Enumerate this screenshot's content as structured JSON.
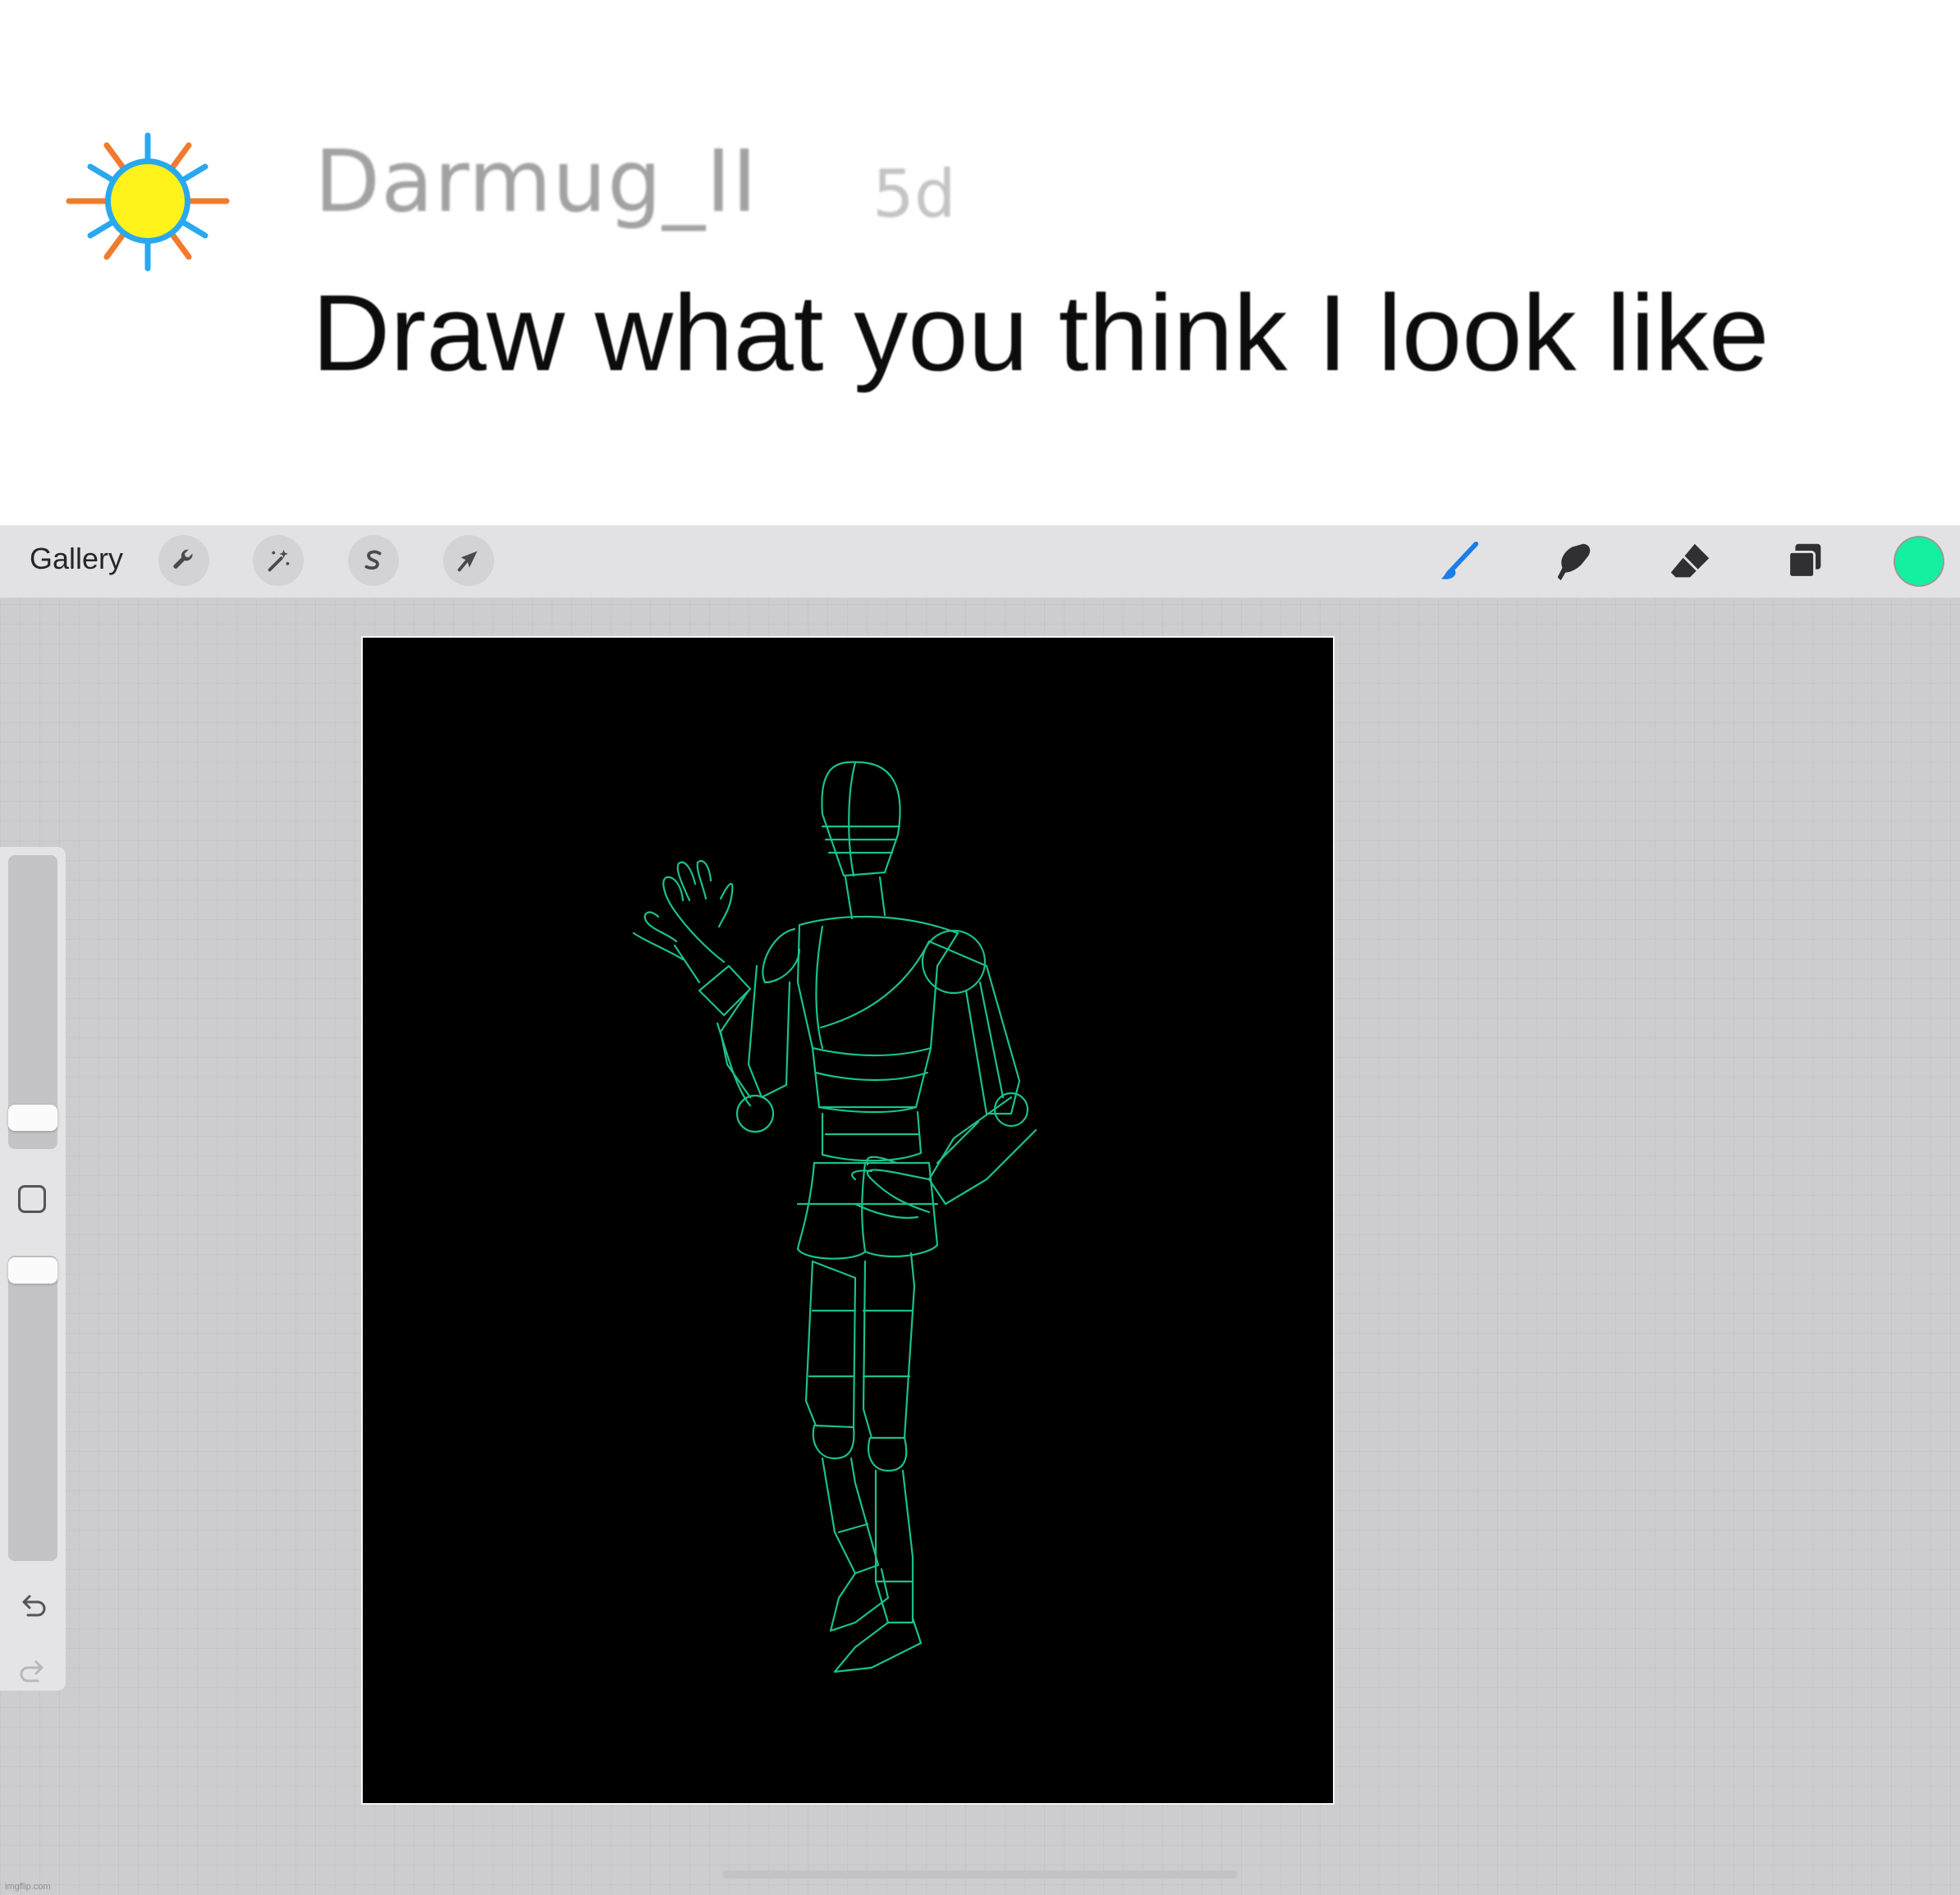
{
  "comment": {
    "username": "Darmug_II",
    "age": "5d",
    "text": "Draw what you think I look like",
    "avatar_icon": "sun-icon"
  },
  "app": {
    "toolbar": {
      "gallery_label": "Gallery",
      "left_tools": [
        "wrench-icon",
        "magic-wand-icon",
        "selection-s-icon",
        "transform-arrow-icon"
      ],
      "right_tools": [
        "brush-icon",
        "smudge-icon",
        "eraser-icon",
        "layers-icon"
      ],
      "active_tool": "brush-icon",
      "active_color": "#14f0a0",
      "brush_accent": "#1a7de8"
    },
    "canvas": {
      "background": "#000000",
      "stroke_color": "#1ed69a"
    },
    "sidebar": {
      "brush_size_level": 0.28,
      "opacity_level": 1.0,
      "undo_icon": "undo-icon",
      "redo_icon": "redo-icon"
    },
    "watermark": "imgflip.com"
  }
}
